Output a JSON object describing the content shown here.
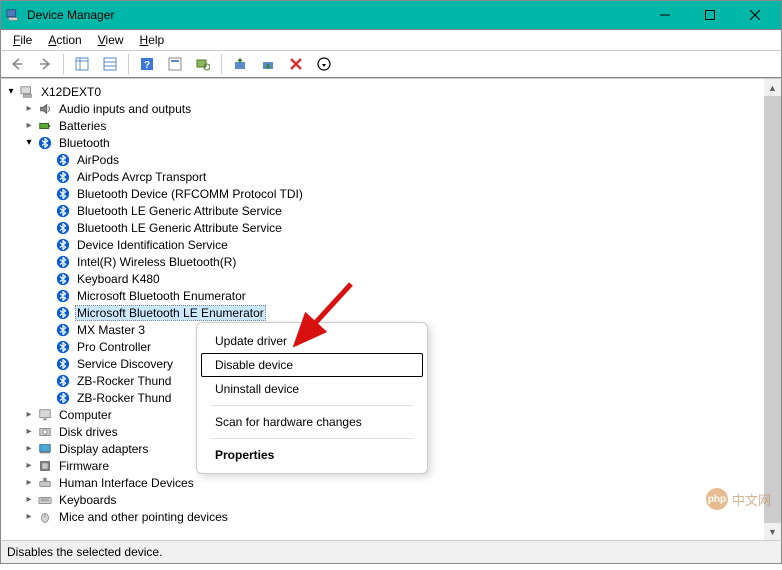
{
  "window": {
    "title": "Device Manager"
  },
  "menu": {
    "file": "File",
    "action": "Action",
    "view": "View",
    "help": "Help"
  },
  "root": "X12DEXT0",
  "cat": {
    "audio": "Audio inputs and outputs",
    "batteries": "Batteries",
    "bluetooth": "Bluetooth",
    "computer": "Computer",
    "disk": "Disk drives",
    "display": "Display adapters",
    "firmware": "Firmware",
    "hid": "Human Interface Devices",
    "keyboards": "Keyboards",
    "mice": "Mice and other pointing devices"
  },
  "bt": [
    "AirPods",
    "AirPods Avrcp Transport",
    "Bluetooth Device (RFCOMM Protocol TDI)",
    "Bluetooth LE Generic Attribute Service",
    "Bluetooth LE Generic Attribute Service",
    "Device Identification Service",
    "Intel(R) Wireless Bluetooth(R)",
    "Keyboard K480",
    "Microsoft Bluetooth Enumerator",
    "Microsoft Bluetooth LE Enumerator",
    "MX Master 3",
    "Pro Controller",
    "Service Discovery",
    "ZB-Rocker Thund",
    "ZB-Rocker Thund"
  ],
  "ctx": {
    "update": "Update driver",
    "disable": "Disable device",
    "uninstall": "Uninstall device",
    "scan": "Scan for hardware changes",
    "properties": "Properties"
  },
  "status": "Disables the selected device.",
  "watermark": "中文网",
  "watermark_prefix": "php"
}
